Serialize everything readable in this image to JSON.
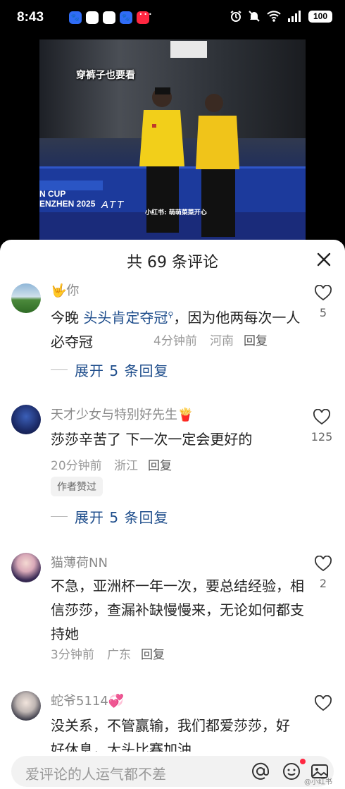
{
  "status_bar": {
    "time": "8:43",
    "battery": "100",
    "dots": "···"
  },
  "video": {
    "caption": "穿裤子也要看",
    "cup_text_1": "N CUP",
    "cup_text_2": "ENZHEN 2025",
    "brand": "ATT",
    "watermark": "小红书: 萌萌菜菜开心"
  },
  "sheet": {
    "title": "共 69 条评论",
    "close_icon": "close-icon"
  },
  "comments": [
    {
      "name": "🤟你",
      "text_prefix": "今晚 ",
      "mention": "头头肯定夺冠",
      "text_suffix": "，因为他两每次一人必夺冠",
      "time": "4分钟前",
      "location": "河南",
      "reply": "回复",
      "likes": "5",
      "expand": "展开 5 条回复"
    },
    {
      "name": "天才少女与特别好先生",
      "name_emoji": "🍟",
      "text": "莎莎辛苦了 下一次一定会更好的",
      "time": "20分钟前",
      "location": "浙江",
      "reply": "回复",
      "tag": "作者赞过",
      "likes": "125",
      "expand": "展开 5 条回复"
    },
    {
      "name": "猫薄荷NN",
      "text": "不急，亚洲杯一年一次，要总结经验，相信莎莎，查漏补缺慢慢来，无论如何都支持她",
      "time": "3分钟前",
      "location": "广东",
      "reply": "回复",
      "likes": "2"
    },
    {
      "name": "蛇爷5114",
      "name_emoji": "💞",
      "text": "没关系，不管赢输，我们都爱莎莎，好好休息，大头比赛加油",
      "likes": ""
    }
  ],
  "input": {
    "placeholder": "爱评论的人运气都不差",
    "watermark": "@小红书"
  },
  "colors": {
    "link": "#1f4e8c",
    "meta": "#999999",
    "accent_red": "#ff2741"
  }
}
